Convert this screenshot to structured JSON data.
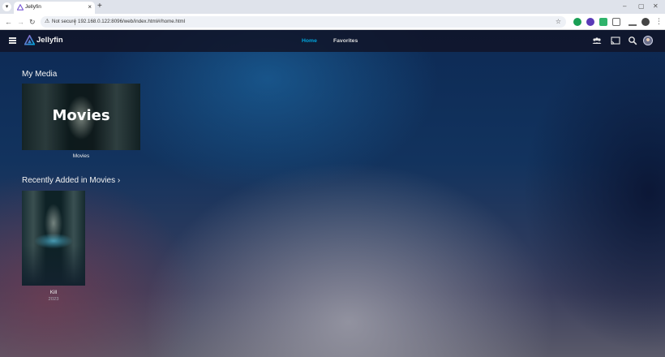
{
  "browser": {
    "tab_title": "Jellyfin",
    "tab_close": "×",
    "new_tab": "+",
    "window_controls": [
      "–",
      "▢",
      "✕"
    ],
    "security_label": "Not secure",
    "url": "192.168.0.122:8096/web/index.html#/home.html"
  },
  "app": {
    "brand": "Jellyfin",
    "nav": {
      "home": "Home",
      "favorites": "Favorites"
    },
    "active_nav": "Home",
    "accent": "#00a4dc"
  },
  "my_media": {
    "title": "My Media",
    "items": [
      {
        "label": "Movies",
        "caption": "Movies"
      }
    ]
  },
  "recently_added": {
    "title": "Recently Added in Movies ›",
    "items": [
      {
        "title": "Kill",
        "year": "2023"
      }
    ]
  }
}
